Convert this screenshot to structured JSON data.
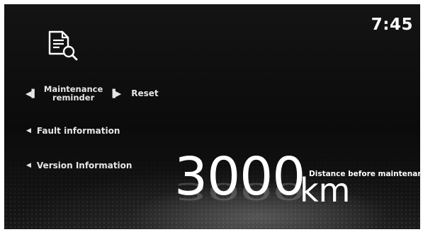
{
  "status": {
    "clock": "7:45"
  },
  "menu": {
    "maintenance_line1": "Maintenance",
    "maintenance_line2": "reminder",
    "reset_label": "Reset",
    "fault_label": "Fault information",
    "version_label": "Version Information"
  },
  "distance": {
    "value": "3000",
    "unit": "km",
    "label": "Distance before maintenance"
  },
  "icons": {
    "document": "document-search-icon",
    "left_arrow": "arrow-left-icon",
    "right_arrow": "arrow-right-icon"
  },
  "colors": {
    "background": "#0b0b0b",
    "text": "#ffffff"
  }
}
